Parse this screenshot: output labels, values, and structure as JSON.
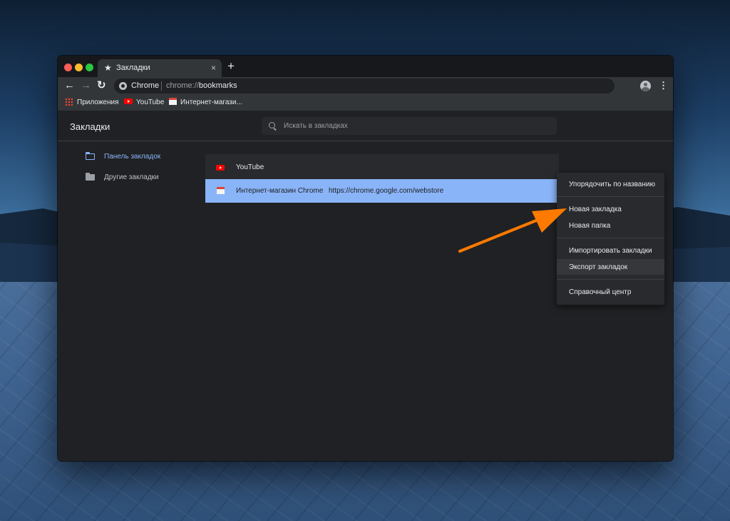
{
  "tab": {
    "title": "Закладки",
    "close": "×",
    "new_tab": "+"
  },
  "toolbar": {
    "back": "←",
    "forward": "→",
    "reload": "↻",
    "omnibox_site": "Chrome",
    "url_scheme": "chrome://",
    "url_path": "bookmarks",
    "star": "☆",
    "menu": "⋮"
  },
  "bookmarks_bar": {
    "items": [
      {
        "label": "Приложения",
        "icon": "apps-icon"
      },
      {
        "label": "YouTube",
        "icon": "youtube-icon"
      },
      {
        "label": "Интернет-магази...",
        "icon": "webstore-icon"
      }
    ]
  },
  "page": {
    "title": "Закладки",
    "search_placeholder": "Искать в закладках"
  },
  "sidebar": {
    "folders": [
      {
        "label": "Панель закладок",
        "active": true
      },
      {
        "label": "Другие закладки",
        "active": false
      }
    ]
  },
  "list": {
    "rows": [
      {
        "title": "YouTube",
        "url": "",
        "icon": "youtube-icon",
        "selected": false
      },
      {
        "title": "Интернет-магазин Chrome",
        "url": "https://chrome.google.com/webstore",
        "icon": "webstore-icon",
        "selected": true
      }
    ]
  },
  "menu": {
    "items": [
      "Упорядочить по названию",
      "Новая закладка",
      "Новая папка",
      "Импортировать закладки",
      "Экспорт закладок",
      "Справочный центр"
    ],
    "hovered_index": 4
  },
  "colors": {
    "accent": "#8ab4f8",
    "annotation_arrow": "#ff7a00",
    "background": "#202124"
  }
}
